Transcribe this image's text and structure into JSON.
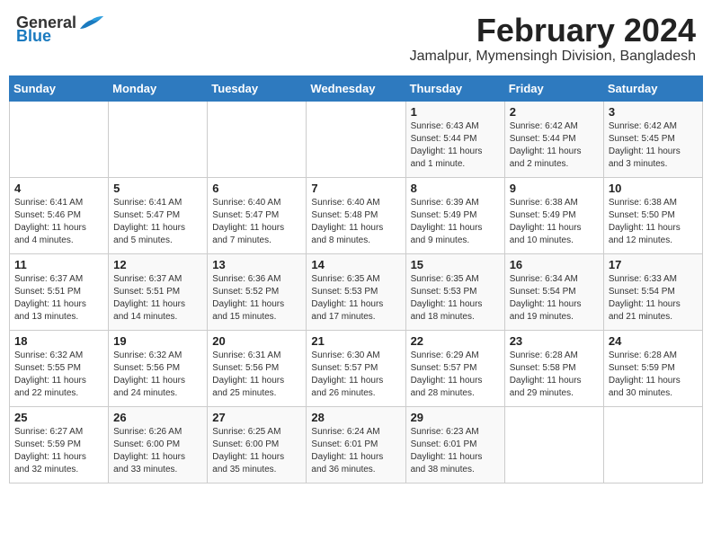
{
  "header": {
    "logo": {
      "text_general": "General",
      "text_blue": "Blue",
      "icon": "bird"
    },
    "title": "February 2024",
    "subtitle": "Jamalpur, Mymensingh Division, Bangladesh"
  },
  "columns": [
    "Sunday",
    "Monday",
    "Tuesday",
    "Wednesday",
    "Thursday",
    "Friday",
    "Saturday"
  ],
  "weeks": [
    [
      {
        "day": "",
        "info": ""
      },
      {
        "day": "",
        "info": ""
      },
      {
        "day": "",
        "info": ""
      },
      {
        "day": "",
        "info": ""
      },
      {
        "day": "1",
        "info": "Sunrise: 6:43 AM\nSunset: 5:44 PM\nDaylight: 11 hours and 1 minute."
      },
      {
        "day": "2",
        "info": "Sunrise: 6:42 AM\nSunset: 5:44 PM\nDaylight: 11 hours and 2 minutes."
      },
      {
        "day": "3",
        "info": "Sunrise: 6:42 AM\nSunset: 5:45 PM\nDaylight: 11 hours and 3 minutes."
      }
    ],
    [
      {
        "day": "4",
        "info": "Sunrise: 6:41 AM\nSunset: 5:46 PM\nDaylight: 11 hours and 4 minutes."
      },
      {
        "day": "5",
        "info": "Sunrise: 6:41 AM\nSunset: 5:47 PM\nDaylight: 11 hours and 5 minutes."
      },
      {
        "day": "6",
        "info": "Sunrise: 6:40 AM\nSunset: 5:47 PM\nDaylight: 11 hours and 7 minutes."
      },
      {
        "day": "7",
        "info": "Sunrise: 6:40 AM\nSunset: 5:48 PM\nDaylight: 11 hours and 8 minutes."
      },
      {
        "day": "8",
        "info": "Sunrise: 6:39 AM\nSunset: 5:49 PM\nDaylight: 11 hours and 9 minutes."
      },
      {
        "day": "9",
        "info": "Sunrise: 6:38 AM\nSunset: 5:49 PM\nDaylight: 11 hours and 10 minutes."
      },
      {
        "day": "10",
        "info": "Sunrise: 6:38 AM\nSunset: 5:50 PM\nDaylight: 11 hours and 12 minutes."
      }
    ],
    [
      {
        "day": "11",
        "info": "Sunrise: 6:37 AM\nSunset: 5:51 PM\nDaylight: 11 hours and 13 minutes."
      },
      {
        "day": "12",
        "info": "Sunrise: 6:37 AM\nSunset: 5:51 PM\nDaylight: 11 hours and 14 minutes."
      },
      {
        "day": "13",
        "info": "Sunrise: 6:36 AM\nSunset: 5:52 PM\nDaylight: 11 hours and 15 minutes."
      },
      {
        "day": "14",
        "info": "Sunrise: 6:35 AM\nSunset: 5:53 PM\nDaylight: 11 hours and 17 minutes."
      },
      {
        "day": "15",
        "info": "Sunrise: 6:35 AM\nSunset: 5:53 PM\nDaylight: 11 hours and 18 minutes."
      },
      {
        "day": "16",
        "info": "Sunrise: 6:34 AM\nSunset: 5:54 PM\nDaylight: 11 hours and 19 minutes."
      },
      {
        "day": "17",
        "info": "Sunrise: 6:33 AM\nSunset: 5:54 PM\nDaylight: 11 hours and 21 minutes."
      }
    ],
    [
      {
        "day": "18",
        "info": "Sunrise: 6:32 AM\nSunset: 5:55 PM\nDaylight: 11 hours and 22 minutes."
      },
      {
        "day": "19",
        "info": "Sunrise: 6:32 AM\nSunset: 5:56 PM\nDaylight: 11 hours and 24 minutes."
      },
      {
        "day": "20",
        "info": "Sunrise: 6:31 AM\nSunset: 5:56 PM\nDaylight: 11 hours and 25 minutes."
      },
      {
        "day": "21",
        "info": "Sunrise: 6:30 AM\nSunset: 5:57 PM\nDaylight: 11 hours and 26 minutes."
      },
      {
        "day": "22",
        "info": "Sunrise: 6:29 AM\nSunset: 5:57 PM\nDaylight: 11 hours and 28 minutes."
      },
      {
        "day": "23",
        "info": "Sunrise: 6:28 AM\nSunset: 5:58 PM\nDaylight: 11 hours and 29 minutes."
      },
      {
        "day": "24",
        "info": "Sunrise: 6:28 AM\nSunset: 5:59 PM\nDaylight: 11 hours and 30 minutes."
      }
    ],
    [
      {
        "day": "25",
        "info": "Sunrise: 6:27 AM\nSunset: 5:59 PM\nDaylight: 11 hours and 32 minutes."
      },
      {
        "day": "26",
        "info": "Sunrise: 6:26 AM\nSunset: 6:00 PM\nDaylight: 11 hours and 33 minutes."
      },
      {
        "day": "27",
        "info": "Sunrise: 6:25 AM\nSunset: 6:00 PM\nDaylight: 11 hours and 35 minutes."
      },
      {
        "day": "28",
        "info": "Sunrise: 6:24 AM\nSunset: 6:01 PM\nDaylight: 11 hours and 36 minutes."
      },
      {
        "day": "29",
        "info": "Sunrise: 6:23 AM\nSunset: 6:01 PM\nDaylight: 11 hours and 38 minutes."
      },
      {
        "day": "",
        "info": ""
      },
      {
        "day": "",
        "info": ""
      }
    ]
  ]
}
